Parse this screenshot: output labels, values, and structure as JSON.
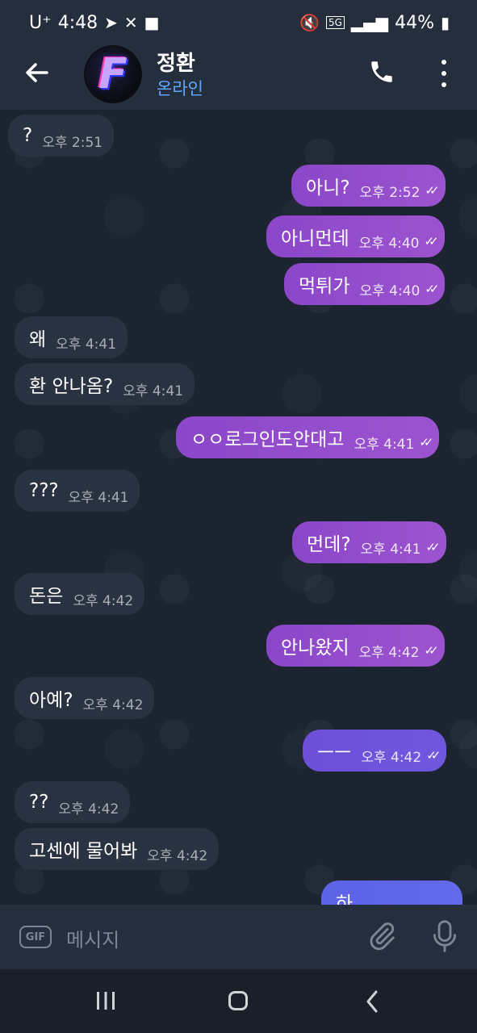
{
  "status_bar": {
    "carrier": "U⁺",
    "time": "4:48",
    "network": "5G",
    "battery": "44%"
  },
  "header": {
    "title": "정환",
    "subtitle": "온라인",
    "avatar_letter": "F"
  },
  "messages": [
    {
      "dir": "in",
      "text": "?",
      "time": "오후 2:51"
    },
    {
      "dir": "out",
      "text": "아니?",
      "time": "오후 2:52",
      "read": true
    },
    {
      "dir": "out",
      "text": "아니먼데",
      "time": "오후 4:40",
      "read": true
    },
    {
      "dir": "out",
      "text": "먹튀가",
      "time": "오후 4:40",
      "read": true
    },
    {
      "dir": "in",
      "text": "왜",
      "time": "오후 4:41"
    },
    {
      "dir": "in",
      "text": "환 안나옴?",
      "time": "오후 4:41"
    },
    {
      "dir": "out",
      "text": "ㅇㅇ로그인도안대고",
      "time": "오후 4:41",
      "read": true
    },
    {
      "dir": "in",
      "text": "???",
      "time": "오후 4:41"
    },
    {
      "dir": "out",
      "text": "먼데?",
      "time": "오후 4:41",
      "read": true
    },
    {
      "dir": "in",
      "text": "돈은",
      "time": "오후 4:42"
    },
    {
      "dir": "out",
      "text": "안나왔지",
      "time": "오후 4:42",
      "read": true
    },
    {
      "dir": "in",
      "text": "아예?",
      "time": "오후 4:42"
    },
    {
      "dir": "out",
      "text": "ㅡㅡ",
      "time": "오후 4:42",
      "read": true
    },
    {
      "dir": "in",
      "text": "??",
      "time": "오후 4:42"
    },
    {
      "dir": "in",
      "text": "고센에 물어봐",
      "time": "오후 4:42"
    },
    {
      "dir": "out",
      "text": "하",
      "time": "",
      "read": false
    }
  ],
  "input": {
    "gif_label": "GIF",
    "placeholder": "메시지"
  },
  "colors": {
    "outgoing_bubble": "#9c53cf",
    "incoming_bubble": "#283241",
    "online_accent": "#5fa9ff",
    "background": "#1c2432"
  },
  "icons": [
    "back-arrow-icon",
    "phone-icon",
    "more-vert-icon",
    "gif-icon",
    "attach-icon",
    "mic-icon",
    "double-check-icon"
  ]
}
